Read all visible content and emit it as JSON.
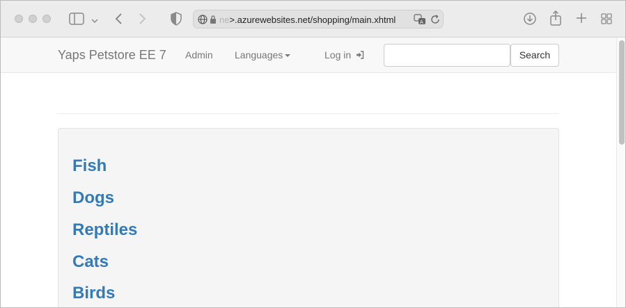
{
  "browser": {
    "url_prefix_faded": "ne",
    "url": ">.azurewebsites.net/shopping/main.xhtml",
    "icons": {
      "sidebar": "sidebar-icon",
      "back": "chevron-left-icon",
      "forward": "chevron-right-icon",
      "shield": "shield-icon",
      "globe": "globe-icon",
      "lock": "lock-icon",
      "translate": "translate-icon",
      "reload": "reload-icon",
      "download": "download-icon",
      "share": "share-icon",
      "new_tab": "plus-icon",
      "tabs": "tab-overview-icon"
    }
  },
  "navbar": {
    "brand": "Yaps Petstore EE 7",
    "admin": "Admin",
    "languages": "Languages",
    "login": "Log in",
    "login_icon": "sign-in-icon",
    "search_placeholder": "",
    "search_button": "Search"
  },
  "categories": [
    {
      "label": "Fish"
    },
    {
      "label": "Dogs"
    },
    {
      "label": "Reptiles"
    },
    {
      "label": "Cats"
    },
    {
      "label": "Birds"
    }
  ],
  "colors": {
    "link": "#337ab7",
    "navbar_bg": "#f8f8f8",
    "well_bg": "#f5f5f5"
  }
}
